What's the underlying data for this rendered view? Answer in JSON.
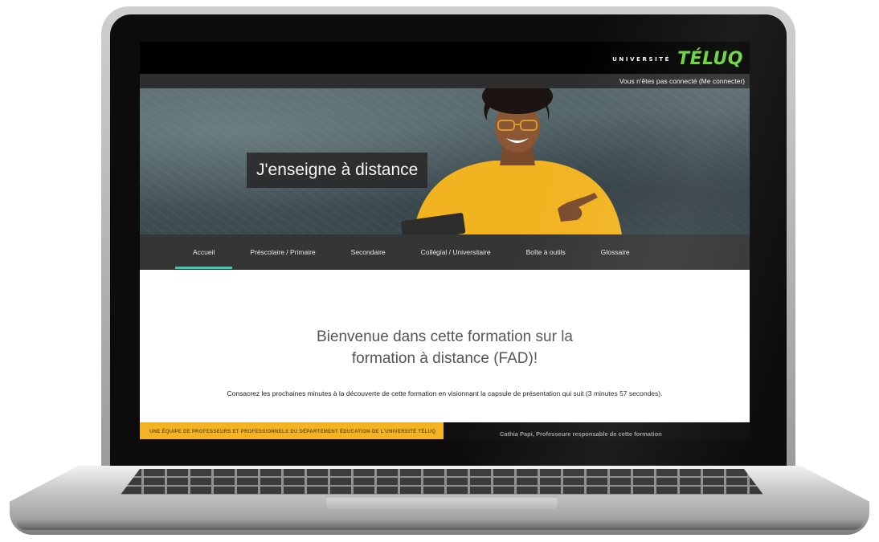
{
  "brand": {
    "small_text": "UNIVERSITÉ",
    "name": "TÉLUQ",
    "accent_color": "#69d23c"
  },
  "login": {
    "text": "Vous n'êtes pas connecté (Me connecter)"
  },
  "hero": {
    "title": "J'enseigne à distance"
  },
  "nav": {
    "items": [
      {
        "label": "Accueil",
        "active": true
      },
      {
        "label": "Préscolaire / Primaire",
        "active": false
      },
      {
        "label": "Secondaire",
        "active": false
      },
      {
        "label": "Collégial / Universitaire",
        "active": false
      },
      {
        "label": "Boîte à outils",
        "active": false
      },
      {
        "label": "Glossaire",
        "active": false
      }
    ],
    "active_color": "#3fc7b0"
  },
  "main": {
    "welcome_line1": "Bienvenue dans cette formation sur la",
    "welcome_line2": "formation à distance (FAD)!",
    "intro": "Consacrez les prochaines minutes à la découverte de cette formation en visionnant la capsule de présentation qui suit (3 minutes 57 secondes)."
  },
  "footer_strip": {
    "left_text": "UNE ÉQUIPE DE PROFESSEURS ET PROFESSIONNELS DU DÉPARTEMENT ÉDUCATION DE L'UNIVERSITÉ TÉLUQ",
    "right_text": "Cathia Papi, Professeure responsable de cette formation",
    "left_color": "#f5b324"
  }
}
